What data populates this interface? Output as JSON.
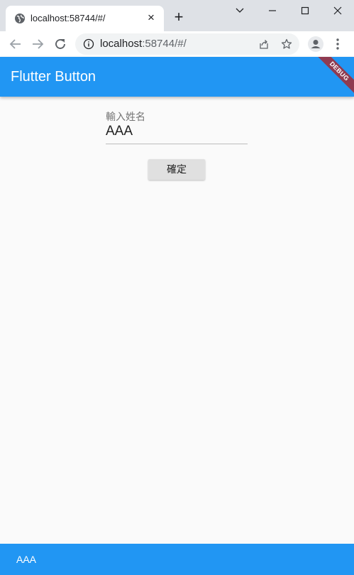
{
  "browser": {
    "tab_title": "localhost:58744/#/",
    "tab_close": "×",
    "new_tab": "+",
    "url_host": "localhost",
    "url_rest": ":58744/#/",
    "icons": {
      "tab": "globe-icon",
      "minimize": "minimize-icon",
      "maximize": "maximize-icon",
      "close": "close-icon",
      "tab_search": "chevron-down-icon",
      "back": "back-arrow-icon",
      "forward": "forward-arrow-icon",
      "reload": "reload-icon",
      "site_info": "info-icon",
      "share": "share-icon",
      "bookmark": "star-icon",
      "profile": "profile-icon",
      "menu": "kebab-menu-icon"
    }
  },
  "app": {
    "title": "Flutter Button",
    "debug_banner": "DEBUG",
    "primary_color": "#2196f3",
    "name_field": {
      "label": "輸入姓名",
      "value": "AAA"
    },
    "confirm_label": "確定",
    "bottom_text": "AAA"
  }
}
